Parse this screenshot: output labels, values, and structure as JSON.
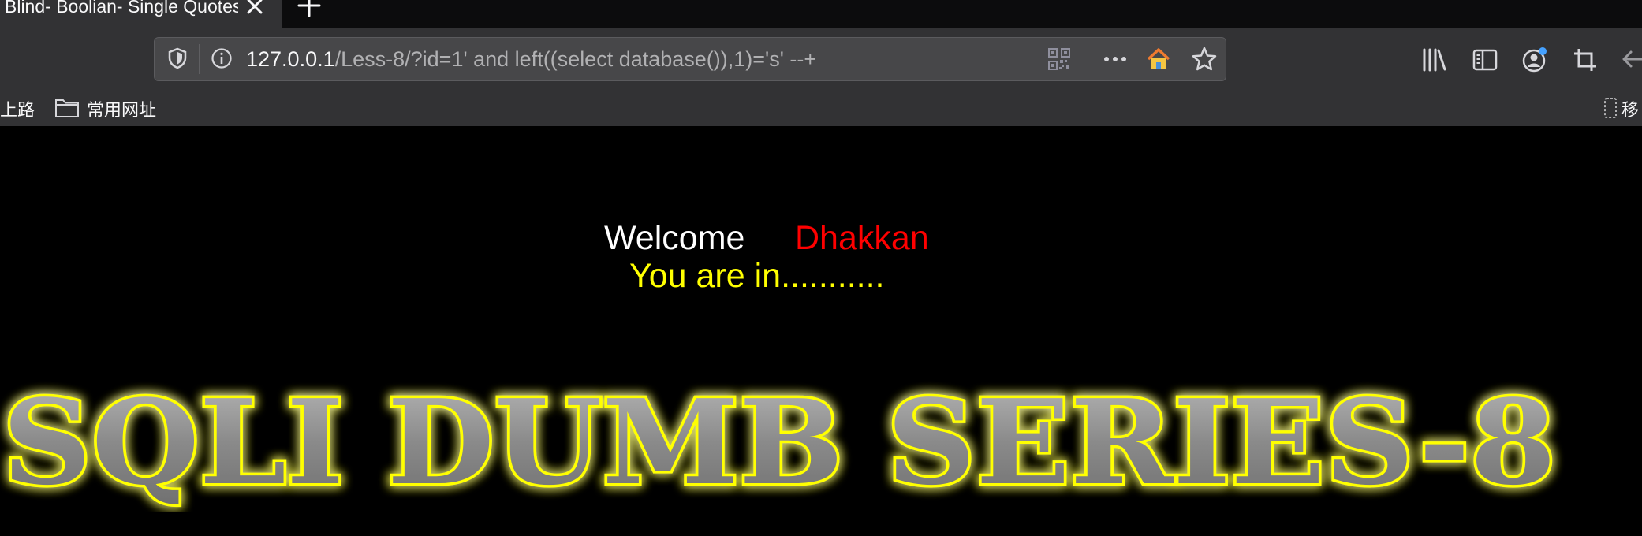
{
  "window": {
    "tab_title": "Blind- Boolian- Single Quotes- String",
    "colors": {
      "tabbar_bg": "#0c0c0d",
      "toolbar_bg": "#323234",
      "urlbar_bg": "#474749"
    }
  },
  "toolbar": {
    "url_host": "127.0.0.1",
    "url_rest": "/Less-8/?id=1' and left((select database()),1)='s' --+",
    "icons": {
      "tracking": "shield-icon",
      "info": "info-icon",
      "qr": "qr-code-icon",
      "more": "more-icon",
      "home": "home-icon",
      "bookmark": "star-icon",
      "library": "library-icon",
      "sidebar": "sidebar-icon",
      "account": "account-icon",
      "screenshot": "crop-icon",
      "back": "back-arrow-icon"
    }
  },
  "bookmarks": {
    "items": [
      {
        "label": "上路"
      },
      {
        "label": "常用网址",
        "icon": "folder-icon"
      },
      {
        "label": "移",
        "icon": "mobile-bookmarks-icon"
      }
    ]
  },
  "page": {
    "welcome_label": "Welcome",
    "user_name": "Dhakkan",
    "status_message": "You are in...........",
    "banner_text": "SQLI DUMB SERIES-8",
    "colors": {
      "welcome": "#ffffff",
      "user": "#ff0000",
      "status": "#ffff00",
      "banner_glow": "#ffff00",
      "banner_fill": "#8a8a8a"
    }
  }
}
